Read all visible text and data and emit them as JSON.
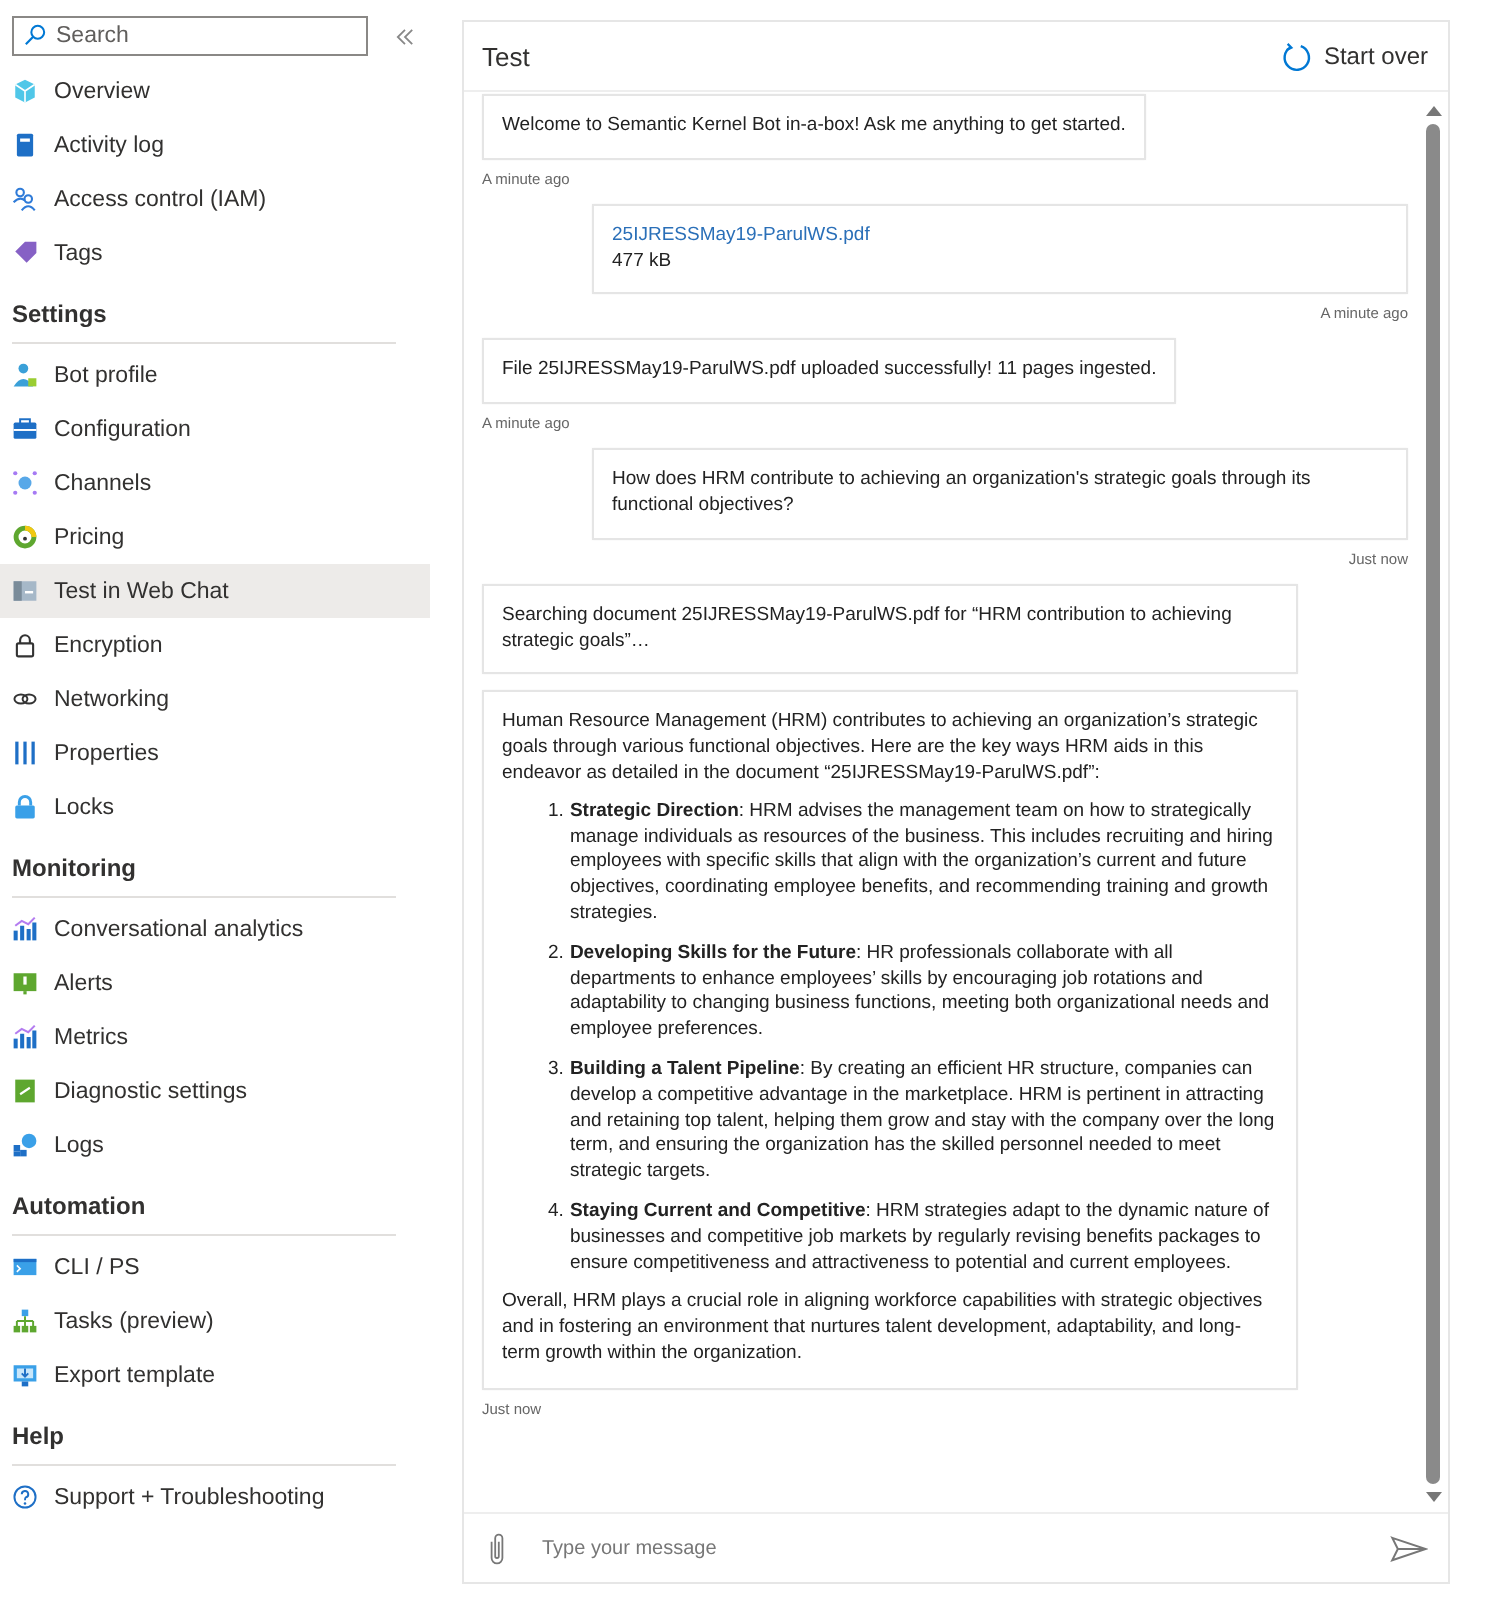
{
  "sidebar": {
    "search": {
      "placeholder": "Search"
    },
    "groups": [
      {
        "items": [
          {
            "label": "Overview",
            "selected": false
          },
          {
            "label": "Activity log",
            "selected": false
          },
          {
            "label": "Access control (IAM)",
            "selected": false
          },
          {
            "label": "Tags",
            "selected": false
          }
        ]
      },
      {
        "heading": "Settings",
        "items": [
          {
            "label": "Bot profile",
            "selected": false
          },
          {
            "label": "Configuration",
            "selected": false
          },
          {
            "label": "Channels",
            "selected": false
          },
          {
            "label": "Pricing",
            "selected": false
          },
          {
            "label": "Test in Web Chat",
            "selected": true
          },
          {
            "label": "Encryption",
            "selected": false
          },
          {
            "label": "Networking",
            "selected": false
          },
          {
            "label": "Properties",
            "selected": false
          },
          {
            "label": "Locks",
            "selected": false
          }
        ]
      },
      {
        "heading": "Monitoring",
        "items": [
          {
            "label": "Conversational analytics",
            "selected": false
          },
          {
            "label": "Alerts",
            "selected": false
          },
          {
            "label": "Metrics",
            "selected": false
          },
          {
            "label": "Diagnostic settings",
            "selected": false
          },
          {
            "label": "Logs",
            "selected": false
          }
        ]
      },
      {
        "heading": "Automation",
        "items": [
          {
            "label": "CLI / PS",
            "selected": false
          },
          {
            "label": "Tasks (preview)",
            "selected": false
          },
          {
            "label": "Export template",
            "selected": false
          }
        ]
      },
      {
        "heading": "Help",
        "items": [
          {
            "label": "Support + Troubleshooting",
            "selected": false
          }
        ]
      }
    ]
  },
  "chat": {
    "title": "Test",
    "start_over": "Start over",
    "messages": [
      {
        "outgoing": false,
        "kind": "text",
        "text": "Welcome to Semantic Kernel Bot in-a-box! Ask me anything to get started.",
        "time": "A minute ago"
      },
      {
        "outgoing": true,
        "kind": "file",
        "file_name": "25IJRESSMay19-ParulWS.pdf",
        "file_size": "477 kB",
        "time": "A minute ago"
      },
      {
        "outgoing": false,
        "kind": "text",
        "text": "File 25IJRESSMay19-ParulWS.pdf uploaded successfully! 11 pages ingested.",
        "time": "A minute ago"
      },
      {
        "outgoing": true,
        "kind": "text",
        "text": "How does HRM contribute to achieving an organization's strategic goals through its functional objectives?",
        "time": "Just now"
      },
      {
        "outgoing": false,
        "kind": "text",
        "text": "Searching document 25IJRESSMay19-ParulWS.pdf for “HRM contribution to achieving strategic goals”…"
      },
      {
        "outgoing": false,
        "kind": "answer",
        "intro": "Human Resource Management (HRM) contributes to achieving an organization’s strategic goals through various functional objectives. Here are the key ways HRM aids in this endeavor as detailed in the document “25IJRESSMay19-ParulWS.pdf”:",
        "points": [
          {
            "number": "1.",
            "text": "**Strategic Direction**: HRM advises the management team on how to strategically manage individuals as resources of the business. This includes recruiting and hiring employees with specific skills that align with the organization’s current and future objectives, coordinating employee benefits, and recommending training and growth strategies."
          },
          {
            "number": "2.",
            "text": "**Developing Skills for the Future**: HR professionals collaborate with all departments to enhance employees’ skills by encouraging job rotations and adaptability to changing business functions, meeting both organizational needs and employee preferences."
          },
          {
            "number": "3.",
            "text": "**Building a Talent Pipeline**: By creating an efficient HR structure, companies can develop a competitive advantage in the marketplace. HRM is pertinent in attracting and retaining top talent, helping them grow and stay with the company over the long term, and ensuring the organization has the skilled personnel needed to meet strategic targets."
          },
          {
            "number": "4.",
            "text": "**Staying Current and Competitive**: HRM strategies adapt to the dynamic nature of businesses and competitive job markets by regularly revising benefits packages to ensure competitiveness and attractiveness to potential and current employees."
          }
        ],
        "outro": "Overall, HRM plays a crucial role in aligning workforce capabilities with strategic objectives and in fostering an environment that nurtures talent development, adaptability, and long-term growth within the organization.",
        "time": "Just now"
      }
    ],
    "composer": {
      "placeholder": "Type your message"
    }
  }
}
